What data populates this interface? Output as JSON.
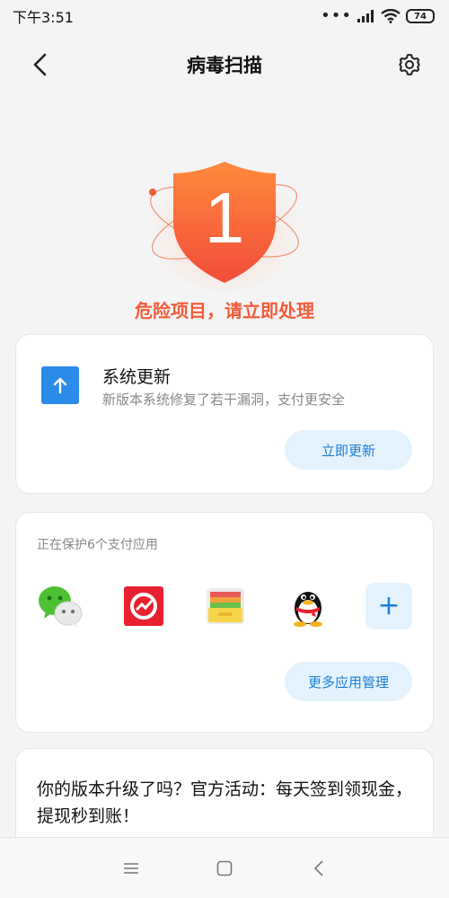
{
  "status_bar": {
    "time": "下午3:51",
    "battery": "74"
  },
  "header": {
    "title": "病毒扫描"
  },
  "scan_result": {
    "count": "1",
    "message": "危险项目，请立即处理",
    "accent": "#f25b3a"
  },
  "update_card": {
    "title": "系统更新",
    "description": "新版本系统修复了若干漏洞，支付更安全",
    "button_label": "立即更新"
  },
  "payment_card": {
    "label": "正在保护6个支付应用",
    "apps": [
      "wechat-icon",
      "payment-app-icon",
      "wallet-icon",
      "qq-icon"
    ],
    "add_label": "+",
    "button_label": "更多应用管理"
  },
  "promo_card": {
    "text": "你的版本升级了吗？官方活动：每天签到领现金，提现秒到账！"
  },
  "colors": {
    "primary_blue": "#1b7fd4",
    "pill_bg": "#e3f2fc",
    "danger": "#f25b3a"
  }
}
